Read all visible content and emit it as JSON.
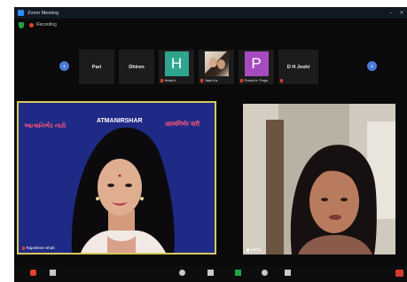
{
  "window": {
    "title": "Zoom Meeting",
    "controls": [
      "minimize-icon",
      "close-icon"
    ]
  },
  "status": {
    "recording_label": "Recording",
    "security_icon": "shield-icon"
  },
  "gallery": {
    "prev_icon": "chevron-left-icon",
    "next_icon": "chevron-right-icon",
    "participants": [
      {
        "name": "Pari",
        "type": "name"
      },
      {
        "name": "Dhiren",
        "type": "name"
      },
      {
        "name": "Hetal",
        "type": "letter",
        "letter": "H",
        "caption": "Hetal k",
        "color": "#2fa58e"
      },
      {
        "name": "Yash",
        "type": "photo",
        "caption": "Yash Ka"
      },
      {
        "name": "Prachi",
        "type": "letter",
        "letter": "P",
        "caption": "Prachi b. Praja",
        "color": "#a64bbf"
      },
      {
        "name": "D H Joshi",
        "type": "name"
      }
    ]
  },
  "speaker": {
    "banner_left": "આત્મનિર્ભર નારી",
    "banner_title": "ATMANIRSHAR",
    "banner_right": "आत्मनिर्भर नारी",
    "name": "Rajeshree Shah",
    "background": "#1f2a86",
    "highlight": "#d9c85c"
  },
  "second_video": {
    "name": "Hetfal"
  },
  "toolbar": {
    "icons": [
      "mic-icon",
      "video-icon",
      "participants-icon",
      "chat-icon",
      "share-screen-icon",
      "record-icon",
      "reactions-icon",
      "end-icon"
    ]
  }
}
